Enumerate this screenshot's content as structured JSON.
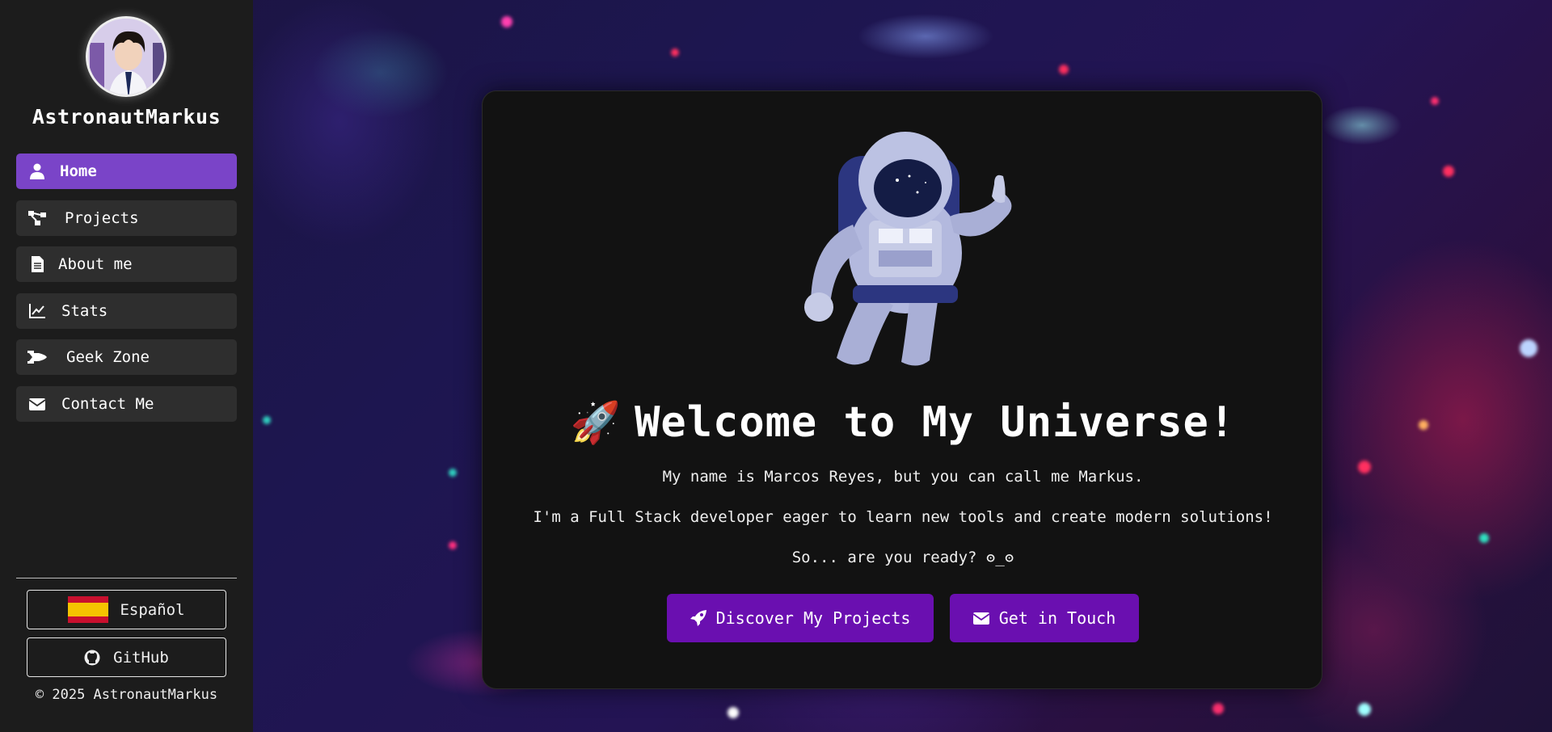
{
  "sidebar": {
    "username": "AstronautMarkus",
    "nav": [
      {
        "label": "Home",
        "icon": "user-icon",
        "active": true
      },
      {
        "label": "Projects",
        "icon": "diagram-icon",
        "active": false
      },
      {
        "label": "About me",
        "icon": "document-icon",
        "active": false
      },
      {
        "label": "Stats",
        "icon": "chart-line-icon",
        "active": false
      },
      {
        "label": "Geek Zone",
        "icon": "spaceship-icon",
        "active": false
      },
      {
        "label": "Contact Me",
        "icon": "envelope-icon",
        "active": false
      }
    ],
    "language_button": "Español",
    "github_button": "GitHub",
    "copyright": "© 2025 AstronautMarkus"
  },
  "hero": {
    "emoji": "🚀",
    "title": "Welcome to My Universe!",
    "line1": "My name is Marcos Reyes, but you can call me Markus.",
    "line2": "I'm a Full Stack developer eager to learn new tools and create modern solutions!",
    "line3": "So... are you ready? ʘ_ʘ",
    "btn_projects": "Discover My Projects",
    "btn_contact": "Get in Touch"
  },
  "colors": {
    "accent": "#7a44c8",
    "cta": "#6a0fb0",
    "sidebar_bg": "#1c1c1c",
    "card_bg": "#121212"
  }
}
